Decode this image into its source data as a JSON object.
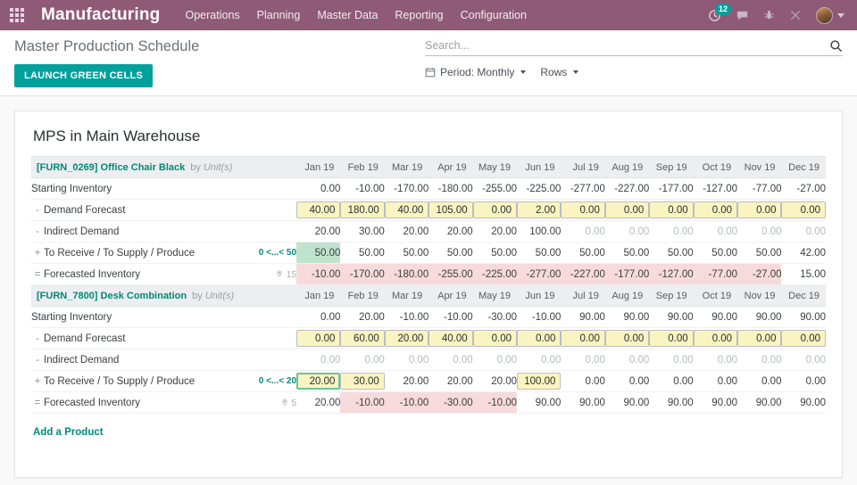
{
  "navbar": {
    "apps_icon": "apps-grid-icon",
    "brand": "Manufacturing",
    "menu": [
      {
        "label": "Operations"
      },
      {
        "label": "Planning"
      },
      {
        "label": "Master Data"
      },
      {
        "label": "Reporting"
      },
      {
        "label": "Configuration"
      }
    ],
    "activity": {
      "icon": "clock-activity-icon",
      "badge": "12"
    },
    "messages": {
      "icon": "chat-bubble-icon"
    },
    "debug": {
      "icon": "bug-icon"
    },
    "tools": {
      "icon": "scissors-icon"
    },
    "user": {
      "icon": "avatar-icon",
      "caret": "chevron-down-icon"
    },
    "accent_color": "#8f5a76"
  },
  "control_panel": {
    "breadcrumb": "Master Production Schedule",
    "primary_button": "LAUNCH GREEN CELLS",
    "search": {
      "placeholder": "Search...",
      "value": "",
      "icon": "search-icon"
    },
    "filters": [
      {
        "label": "Period: Monthly",
        "icon": "calendar-icon"
      },
      {
        "label": "Rows",
        "icon": ""
      }
    ]
  },
  "main": {
    "card_title": "MPS in Main Warehouse",
    "add_product_label": "Add a Product",
    "months": [
      "Jan 19",
      "Feb 19",
      "Mar 19",
      "Apr 19",
      "May 19",
      "Jun 19",
      "Jul 19",
      "Aug 19",
      "Sep 19",
      "Oct 19",
      "Nov 19",
      "Dec 19"
    ],
    "uom_prefix": "by",
    "uom": "Unit(s)",
    "row_labels": {
      "starting_inventory": "Starting Inventory",
      "demand_forecast": "Demand Forecast",
      "indirect_demand": "Indirect Demand",
      "to_receive": "To Receive / To Supply / Produce",
      "forecasted_inventory": "Forecasted Inventory"
    },
    "row_ops": {
      "starting_inventory": "",
      "demand_forecast": "-",
      "indirect_demand": "-",
      "to_receive": "+",
      "forecasted_inventory": "="
    },
    "products": [
      {
        "code_name": "[FURN_0269] Office Chair Black",
        "range_badge": "0 <...< 50",
        "lead_time": "15",
        "starting_inventory": [
          "0.00",
          "-10.00",
          "-170.00",
          "-180.00",
          "-255.00",
          "-225.00",
          "-277.00",
          "-227.00",
          "-177.00",
          "-127.00",
          "-77.00",
          "-27.00"
        ],
        "demand_forecast": [
          "40.00",
          "180.00",
          "40.00",
          "105.00",
          "0.00",
          "2.00",
          "0.00",
          "0.00",
          "0.00",
          "0.00",
          "0.00",
          "0.00"
        ],
        "indirect_demand": [
          "20.00",
          "30.00",
          "20.00",
          "20.00",
          "20.00",
          "100.00",
          "0.00",
          "0.00",
          "0.00",
          "0.00",
          "0.00",
          "0.00"
        ],
        "indirect_demand_muted": [
          false,
          false,
          false,
          false,
          false,
          false,
          true,
          true,
          true,
          true,
          true,
          true
        ],
        "to_receive": [
          "50.00",
          "50.00",
          "50.00",
          "50.00",
          "50.00",
          "50.00",
          "50.00",
          "50.00",
          "50.00",
          "50.00",
          "50.00",
          "42.00"
        ],
        "to_receive_input": [
          false,
          false,
          false,
          false,
          false,
          false,
          false,
          false,
          false,
          false,
          false,
          false
        ],
        "to_receive_highlight": [
          "green",
          "",
          "",
          "",
          "",
          "",
          "",
          "",
          "",
          "",
          "",
          ""
        ],
        "forecasted_inventory": [
          "-10.00",
          "-170.00",
          "-180.00",
          "-255.00",
          "-225.00",
          "-277.00",
          "-227.00",
          "-177.00",
          "-127.00",
          "-77.00",
          "-27.00",
          "15.00"
        ],
        "forecasted_negative": [
          true,
          true,
          true,
          true,
          true,
          true,
          true,
          true,
          true,
          true,
          true,
          false
        ]
      },
      {
        "code_name": "[FURN_7800] Desk Combination",
        "range_badge": "0 <...< 20",
        "lead_time": "5",
        "starting_inventory": [
          "0.00",
          "20.00",
          "-10.00",
          "-10.00",
          "-30.00",
          "-10.00",
          "90.00",
          "90.00",
          "90.00",
          "90.00",
          "90.00",
          "90.00"
        ],
        "demand_forecast": [
          "0.00",
          "60.00",
          "20.00",
          "40.00",
          "0.00",
          "0.00",
          "0.00",
          "0.00",
          "0.00",
          "0.00",
          "0.00",
          "0.00"
        ],
        "indirect_demand": [
          "0.00",
          "0.00",
          "0.00",
          "0.00",
          "0.00",
          "0.00",
          "0.00",
          "0.00",
          "0.00",
          "0.00",
          "0.00",
          "0.00"
        ],
        "indirect_demand_muted": [
          true,
          true,
          true,
          true,
          true,
          true,
          true,
          true,
          true,
          true,
          true,
          true
        ],
        "to_receive": [
          "20.00",
          "30.00",
          "20.00",
          "20.00",
          "20.00",
          "100.00",
          "0.00",
          "0.00",
          "0.00",
          "0.00",
          "0.00",
          "0.00"
        ],
        "to_receive_input": [
          true,
          true,
          false,
          false,
          false,
          true,
          false,
          false,
          false,
          false,
          false,
          false
        ],
        "to_receive_highlight": [
          "green-border",
          "",
          "",
          "",
          "",
          "",
          "",
          "",
          "",
          "",
          "",
          ""
        ],
        "forecasted_inventory": [
          "20.00",
          "-10.00",
          "-10.00",
          "-30.00",
          "-10.00",
          "90.00",
          "90.00",
          "90.00",
          "90.00",
          "90.00",
          "90.00",
          "90.00"
        ],
        "forecasted_negative": [
          false,
          true,
          true,
          true,
          true,
          false,
          false,
          false,
          false,
          false,
          false,
          false
        ]
      }
    ]
  },
  "colors": {
    "brand": "#8f5a76",
    "teal": "#00a09d",
    "negative_bg": "#f7dadb",
    "positive_bg": "#bfe3cd",
    "input_bg": "#faf4c0"
  }
}
